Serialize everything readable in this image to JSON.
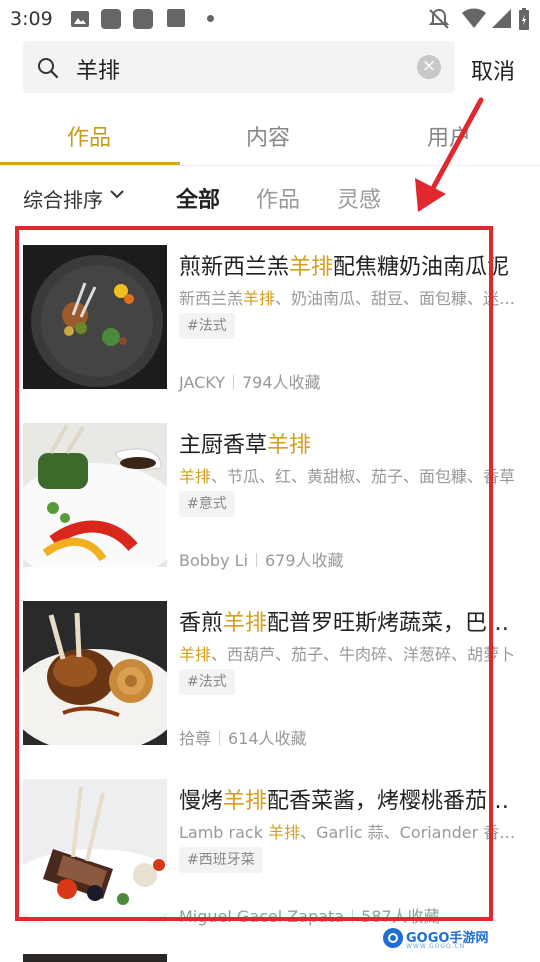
{
  "status_bar": {
    "time": "3:09"
  },
  "search": {
    "query": "羊排",
    "cancel_label": "取消"
  },
  "tabs": [
    {
      "label": "作品",
      "active": true
    },
    {
      "label": "内容",
      "active": false
    },
    {
      "label": "用户",
      "active": false
    }
  ],
  "filters": {
    "sort_label": "综合排序",
    "options": [
      {
        "label": "全部",
        "active": true
      },
      {
        "label": "作品",
        "active": false
      },
      {
        "label": "灵感",
        "active": false
      }
    ]
  },
  "results": [
    {
      "title_pre": "煎新西兰羔",
      "title_hl": "羊排",
      "title_post": "配焦糖奶油南瓜泥",
      "ing_pre": "新西兰羔",
      "ing_hl": "羊排",
      "ing_post": "、奶油南瓜、甜豆、面包糠、迷迭香",
      "tag": "#法式",
      "author": "JACKY",
      "saves": "794人收藏"
    },
    {
      "title_pre": "主厨香草",
      "title_hl": "羊排",
      "title_post": "",
      "ing_pre": "",
      "ing_hl": "羊排",
      "ing_post": "、节瓜、红、黄甜椒、茄子、面包糠、香草",
      "tag": "#意式",
      "author": "Bobby Li",
      "saves": "679人收藏"
    },
    {
      "title_pre": "香煎",
      "title_hl": "羊排",
      "title_post": "配普罗旺斯烤蔬菜，巴萨米克醋汁",
      "ing_pre": "",
      "ing_hl": "羊排",
      "ing_post": "、西葫芦、茄子、牛肉碎、洋葱碎、胡萝卜",
      "tag": "#法式",
      "author": "拾尊",
      "saves": "614人收藏"
    },
    {
      "title_pre": "慢烤",
      "title_hl": "羊排",
      "title_post": "配香菜酱，烤樱桃番茄与土豆",
      "ing_pre": "Lamb rack ",
      "ing_hl": "羊排",
      "ing_post": "、Garlic 蒜、Coriander 香菜、Potato",
      "tag": "#西班牙菜",
      "author": "Miguel Gacel Zapata",
      "saves": "587人收藏"
    }
  ],
  "watermark": {
    "brand": "GOGO手游网",
    "url": "WWW.GOGO.CN"
  },
  "colors": {
    "accent": "#d2a01c",
    "annotation": "#e0292e"
  }
}
